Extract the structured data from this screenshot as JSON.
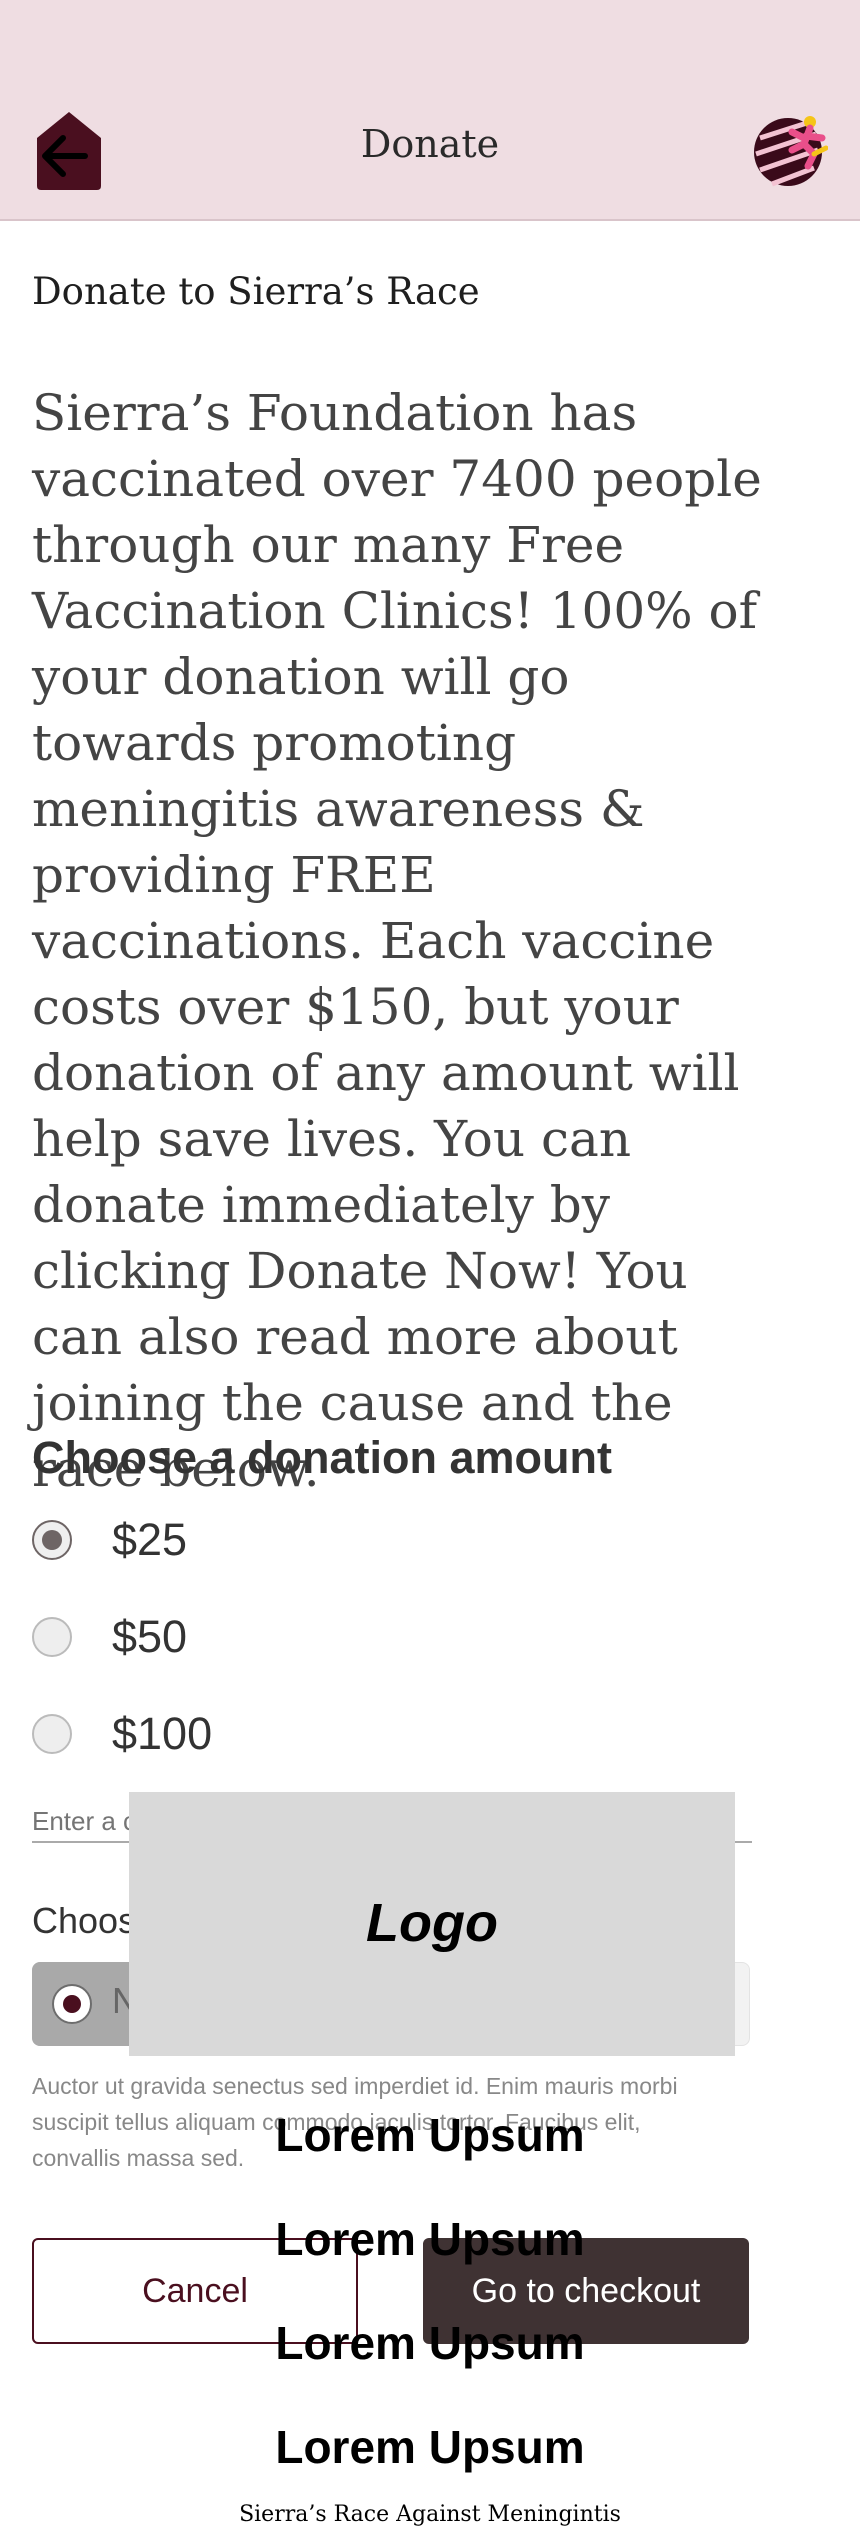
{
  "header": {
    "title": "Donate",
    "back_icon": "back-arrow-icon",
    "avatar_icon": "runner-logo-icon",
    "colors": {
      "background": "#efdde2",
      "back_button": "#4a0f1f",
      "accent": "#e94f8a"
    }
  },
  "main": {
    "heading": "Donate to Sierra’s Race",
    "description": "Sierra’s Foundation has vaccinated over 7400 people through our many Free Vaccination Clinics! 100% of your donation will go towards promoting meningitis awareness & providing FREE vaccinations. Each vaccine costs over $150, but your donation of any amount will help save lives. You can donate immediately by clicking Donate Now! You can also read more about joining the cause and the race below."
  },
  "donation": {
    "title": "Choose a donation amount",
    "options": [
      {
        "label": "$25",
        "selected": true
      },
      {
        "label": "$50",
        "selected": false
      },
      {
        "label": "$100",
        "selected": false
      }
    ],
    "custom_placeholder": "Enter a c",
    "choose_label": "Choos",
    "choice_text": "N",
    "small_print": "Auctor ut gravida senectus sed imperdiet id. Enim mauris morbi suscipit tellus aliquam commodo iaculis tortor. Faucibus elit, convallis massa sed."
  },
  "actions": {
    "cancel_label": "Cancel",
    "checkout_label": "Go to checkout"
  },
  "overlay": {
    "logo_text": "Logo",
    "menu_items": [
      "Lorem Upsum",
      "Lorem Upsum",
      "Lorem Upsum",
      "Lorem Upsum"
    ],
    "footer_caption": "Sierra’s Race Against Meningintis"
  }
}
